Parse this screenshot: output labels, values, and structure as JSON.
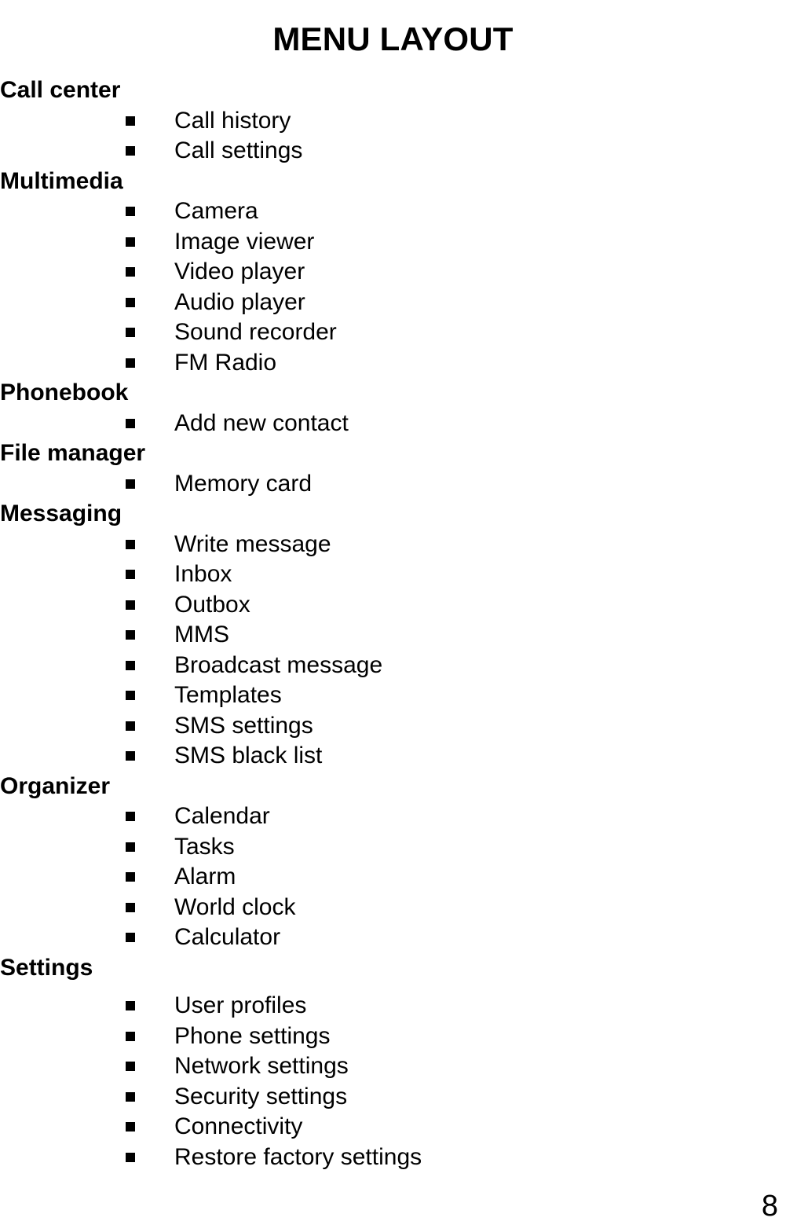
{
  "document": {
    "title": "MENU LAYOUT",
    "page_number": "8",
    "bullet_glyph": "filled-square"
  },
  "sections": [
    {
      "header": "Call center",
      "extra_gap_below_header": false,
      "items": [
        {
          "label": "Call history"
        },
        {
          "label": "Call settings"
        }
      ]
    },
    {
      "header": "Multimedia",
      "extra_gap_below_header": false,
      "items": [
        {
          "label": "Camera"
        },
        {
          "label": "Image viewer"
        },
        {
          "label": "Video player"
        },
        {
          "label": "Audio player"
        },
        {
          "label": "Sound recorder"
        },
        {
          "label": "FM Radio"
        }
      ]
    },
    {
      "header": "Phonebook",
      "extra_gap_below_header": false,
      "items": [
        {
          "label": "Add new contact"
        }
      ]
    },
    {
      "header": "File manager",
      "extra_gap_below_header": false,
      "items": [
        {
          "label": "Memory card"
        }
      ]
    },
    {
      "header": "Messaging",
      "extra_gap_below_header": false,
      "items": [
        {
          "label": "Write message"
        },
        {
          "label": "Inbox"
        },
        {
          "label": "Outbox"
        },
        {
          "label": "MMS"
        },
        {
          "label": "Broadcast message"
        },
        {
          "label": "Templates"
        },
        {
          "label": "SMS settings"
        },
        {
          "label": "SMS black list"
        }
      ]
    },
    {
      "header": "Organizer",
      "extra_gap_below_header": false,
      "items": [
        {
          "label": "Calendar"
        },
        {
          "label": "Tasks"
        },
        {
          "label": "Alarm"
        },
        {
          "label": "World clock"
        },
        {
          "label": "Calculator"
        }
      ]
    },
    {
      "header": "Settings",
      "extra_gap_below_header": true,
      "items": [
        {
          "label": "User profiles"
        },
        {
          "label": "Phone settings"
        },
        {
          "label": "Network settings"
        },
        {
          "label": "Security settings"
        },
        {
          "label": "Connectivity"
        },
        {
          "label": "Restore factory settings"
        }
      ]
    }
  ]
}
